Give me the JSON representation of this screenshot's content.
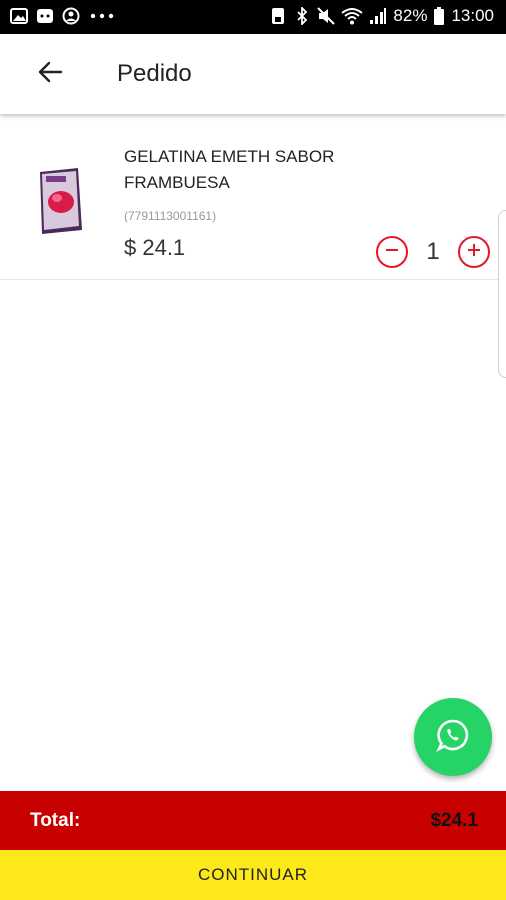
{
  "status_bar": {
    "battery": "82%",
    "time": "13:00",
    "icons": [
      "photo-icon",
      "android-icon",
      "account-icon",
      "more-icon",
      "save-icon",
      "bluetooth-icon",
      "mute-icon",
      "wifi-icon",
      "signal-icon",
      "battery-icon"
    ]
  },
  "header": {
    "title": "Pedido",
    "back_icon": "arrow-left-icon"
  },
  "cart": {
    "items": [
      {
        "name": "GELATINA EMETH SABOR FRAMBUESA",
        "code": "(7791113001161)",
        "price": "$ 24.1",
        "quantity": "1"
      }
    ]
  },
  "fab": {
    "icon": "whatsapp-icon"
  },
  "footer": {
    "total_label": "Total:",
    "total_value": "$24.1",
    "continue_label": "CONTINUAR"
  },
  "colors": {
    "accent_red": "#c80000",
    "button_yellow": "#fde91a",
    "whatsapp_green": "#25d366",
    "qty_red": "#e1192c"
  }
}
